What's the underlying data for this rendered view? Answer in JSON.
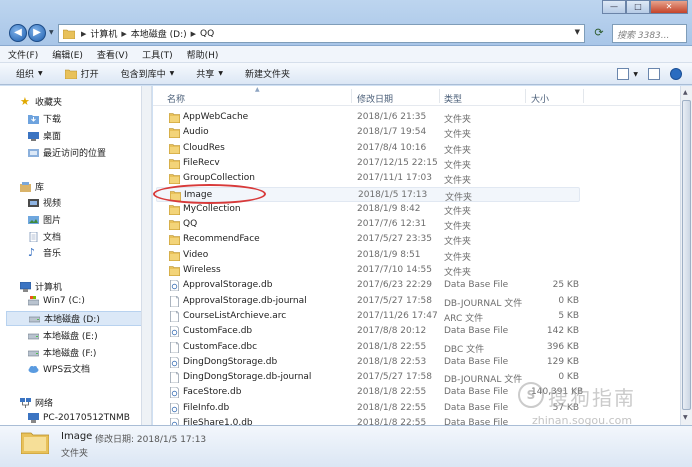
{
  "window": {
    "breadcrumb": [
      "计算机",
      "本地磁盘 (D:)",
      "QQ"
    ],
    "search_placeholder": "搜索 3383...",
    "controls": {
      "minimize": "—",
      "maximize": "□",
      "close": "✕"
    }
  },
  "menu": [
    "文件(F)",
    "编辑(E)",
    "查看(V)",
    "工具(T)",
    "帮助(H)"
  ],
  "toolbar": {
    "organize": "组织",
    "open": "打开",
    "include_in_library": "包含到库中",
    "share": "共享",
    "new_folder": "新建文件夹"
  },
  "nav": {
    "favorites_label": "收藏夹",
    "favorites": [
      "下载",
      "桌面",
      "最近访问的位置"
    ],
    "libraries_label": "库",
    "libraries": [
      "视频",
      "图片",
      "文档",
      "音乐"
    ],
    "computer_label": "计算机",
    "drives": [
      "Win7 (C:)",
      "本地磁盘 (D:)",
      "本地磁盘 (E:)",
      "本地磁盘 (F:)",
      "WPS云文档"
    ],
    "network_label": "网络",
    "network": [
      "PC-20170512TNMB"
    ]
  },
  "columns": {
    "name": "名称",
    "date": "修改日期",
    "type": "类型",
    "size": "大小"
  },
  "files": [
    {
      "name": "AppWebCache",
      "date": "2018/1/6 21:35",
      "type": "文件夹",
      "size": "",
      "kind": "folder"
    },
    {
      "name": "Audio",
      "date": "2018/1/7 19:54",
      "type": "文件夹",
      "size": "",
      "kind": "folder"
    },
    {
      "name": "CloudRes",
      "date": "2017/8/4 10:16",
      "type": "文件夹",
      "size": "",
      "kind": "folder"
    },
    {
      "name": "FileRecv",
      "date": "2017/12/15 22:15",
      "type": "文件夹",
      "size": "",
      "kind": "folder"
    },
    {
      "name": "GroupCollection",
      "date": "2017/11/1 17:03",
      "type": "文件夹",
      "size": "",
      "kind": "folder"
    },
    {
      "name": "Image",
      "date": "2018/1/5 17:13",
      "type": "文件夹",
      "size": "",
      "kind": "folder"
    },
    {
      "name": "MyCollection",
      "date": "2018/1/9 8:42",
      "type": "文件夹",
      "size": "",
      "kind": "folder"
    },
    {
      "name": "QQ",
      "date": "2017/7/6 12:31",
      "type": "文件夹",
      "size": "",
      "kind": "folder"
    },
    {
      "name": "RecommendFace",
      "date": "2017/5/27 23:35",
      "type": "文件夹",
      "size": "",
      "kind": "folder"
    },
    {
      "name": "Video",
      "date": "2018/1/9 8:51",
      "type": "文件夹",
      "size": "",
      "kind": "folder"
    },
    {
      "name": "Wireless",
      "date": "2017/7/10 14:55",
      "type": "文件夹",
      "size": "",
      "kind": "folder"
    },
    {
      "name": "ApprovalStorage.db",
      "date": "2017/6/23 22:29",
      "type": "Data Base File",
      "size": "25 KB",
      "kind": "db"
    },
    {
      "name": "ApprovalStorage.db-journal",
      "date": "2017/5/27 17:58",
      "type": "DB-JOURNAL 文件",
      "size": "0 KB",
      "kind": "file"
    },
    {
      "name": "CourseListArchieve.arc",
      "date": "2017/11/26 17:47",
      "type": "ARC 文件",
      "size": "5 KB",
      "kind": "file"
    },
    {
      "name": "CustomFace.db",
      "date": "2017/8/8 20:12",
      "type": "Data Base File",
      "size": "142 KB",
      "kind": "db"
    },
    {
      "name": "CustomFace.dbc",
      "date": "2018/1/8 22:55",
      "type": "DBC 文件",
      "size": "396 KB",
      "kind": "file"
    },
    {
      "name": "DingDongStorage.db",
      "date": "2018/1/8 22:53",
      "type": "Data Base File",
      "size": "129 KB",
      "kind": "db"
    },
    {
      "name": "DingDongStorage.db-journal",
      "date": "2017/5/27 17:58",
      "type": "DB-JOURNAL 文件",
      "size": "0 KB",
      "kind": "file"
    },
    {
      "name": "FaceStore.db",
      "date": "2018/1/8 22:55",
      "type": "Data Base File",
      "size": "140,391 KB",
      "kind": "db"
    },
    {
      "name": "FileInfo.db",
      "date": "2018/1/8 22:55",
      "type": "Data Base File",
      "size": "57 KB",
      "kind": "db"
    },
    {
      "name": "FileShare1.0.db",
      "date": "2018/1/8 22:55",
      "type": "Data Base File",
      "size": "",
      "kind": "db"
    }
  ],
  "details": {
    "name": "Image",
    "modified_label": "修改日期:",
    "modified_value": "2018/1/5 17:13",
    "type": "文件夹"
  },
  "watermark": {
    "logo": "S",
    "text": "搜狗指南",
    "url": "zhinan.sogou.com"
  },
  "colors": {
    "selection": "#dbe8f7",
    "annotation": "#d83a3a",
    "folder": "#e8c15a"
  }
}
